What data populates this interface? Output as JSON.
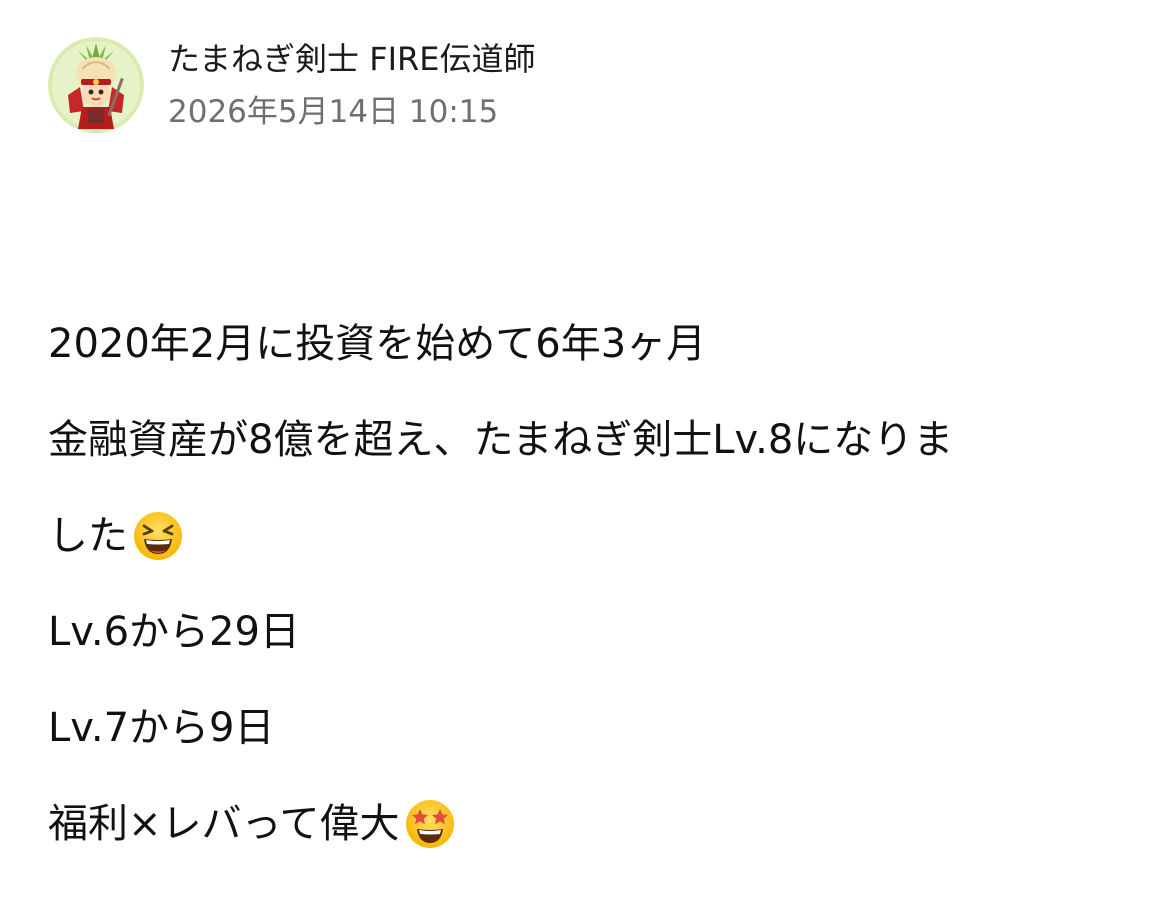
{
  "post": {
    "author_name": "たまねぎ剣士 FIRE伝道師",
    "timestamp": "2026年5月14日 10:15",
    "avatar_icon": "onion-samurai-avatar",
    "lines": {
      "l1": "2020年2月に投資を始めて6年3ヶ月",
      "l2": "金融資産が8億を超え、たまねぎ剣士Lv.8になりま",
      "l3": "した",
      "l4": "Lv.6から29日",
      "l5": "Lv.7から9日",
      "l6": "福利×レバって偉大"
    },
    "emojis": {
      "laughing": "grinning-squinting-face-icon",
      "star_struck": "star-struck-face-icon"
    }
  },
  "colors": {
    "text": "#111111",
    "meta_text": "#6f6f6f",
    "avatar_bg": "#d8ecb0"
  }
}
